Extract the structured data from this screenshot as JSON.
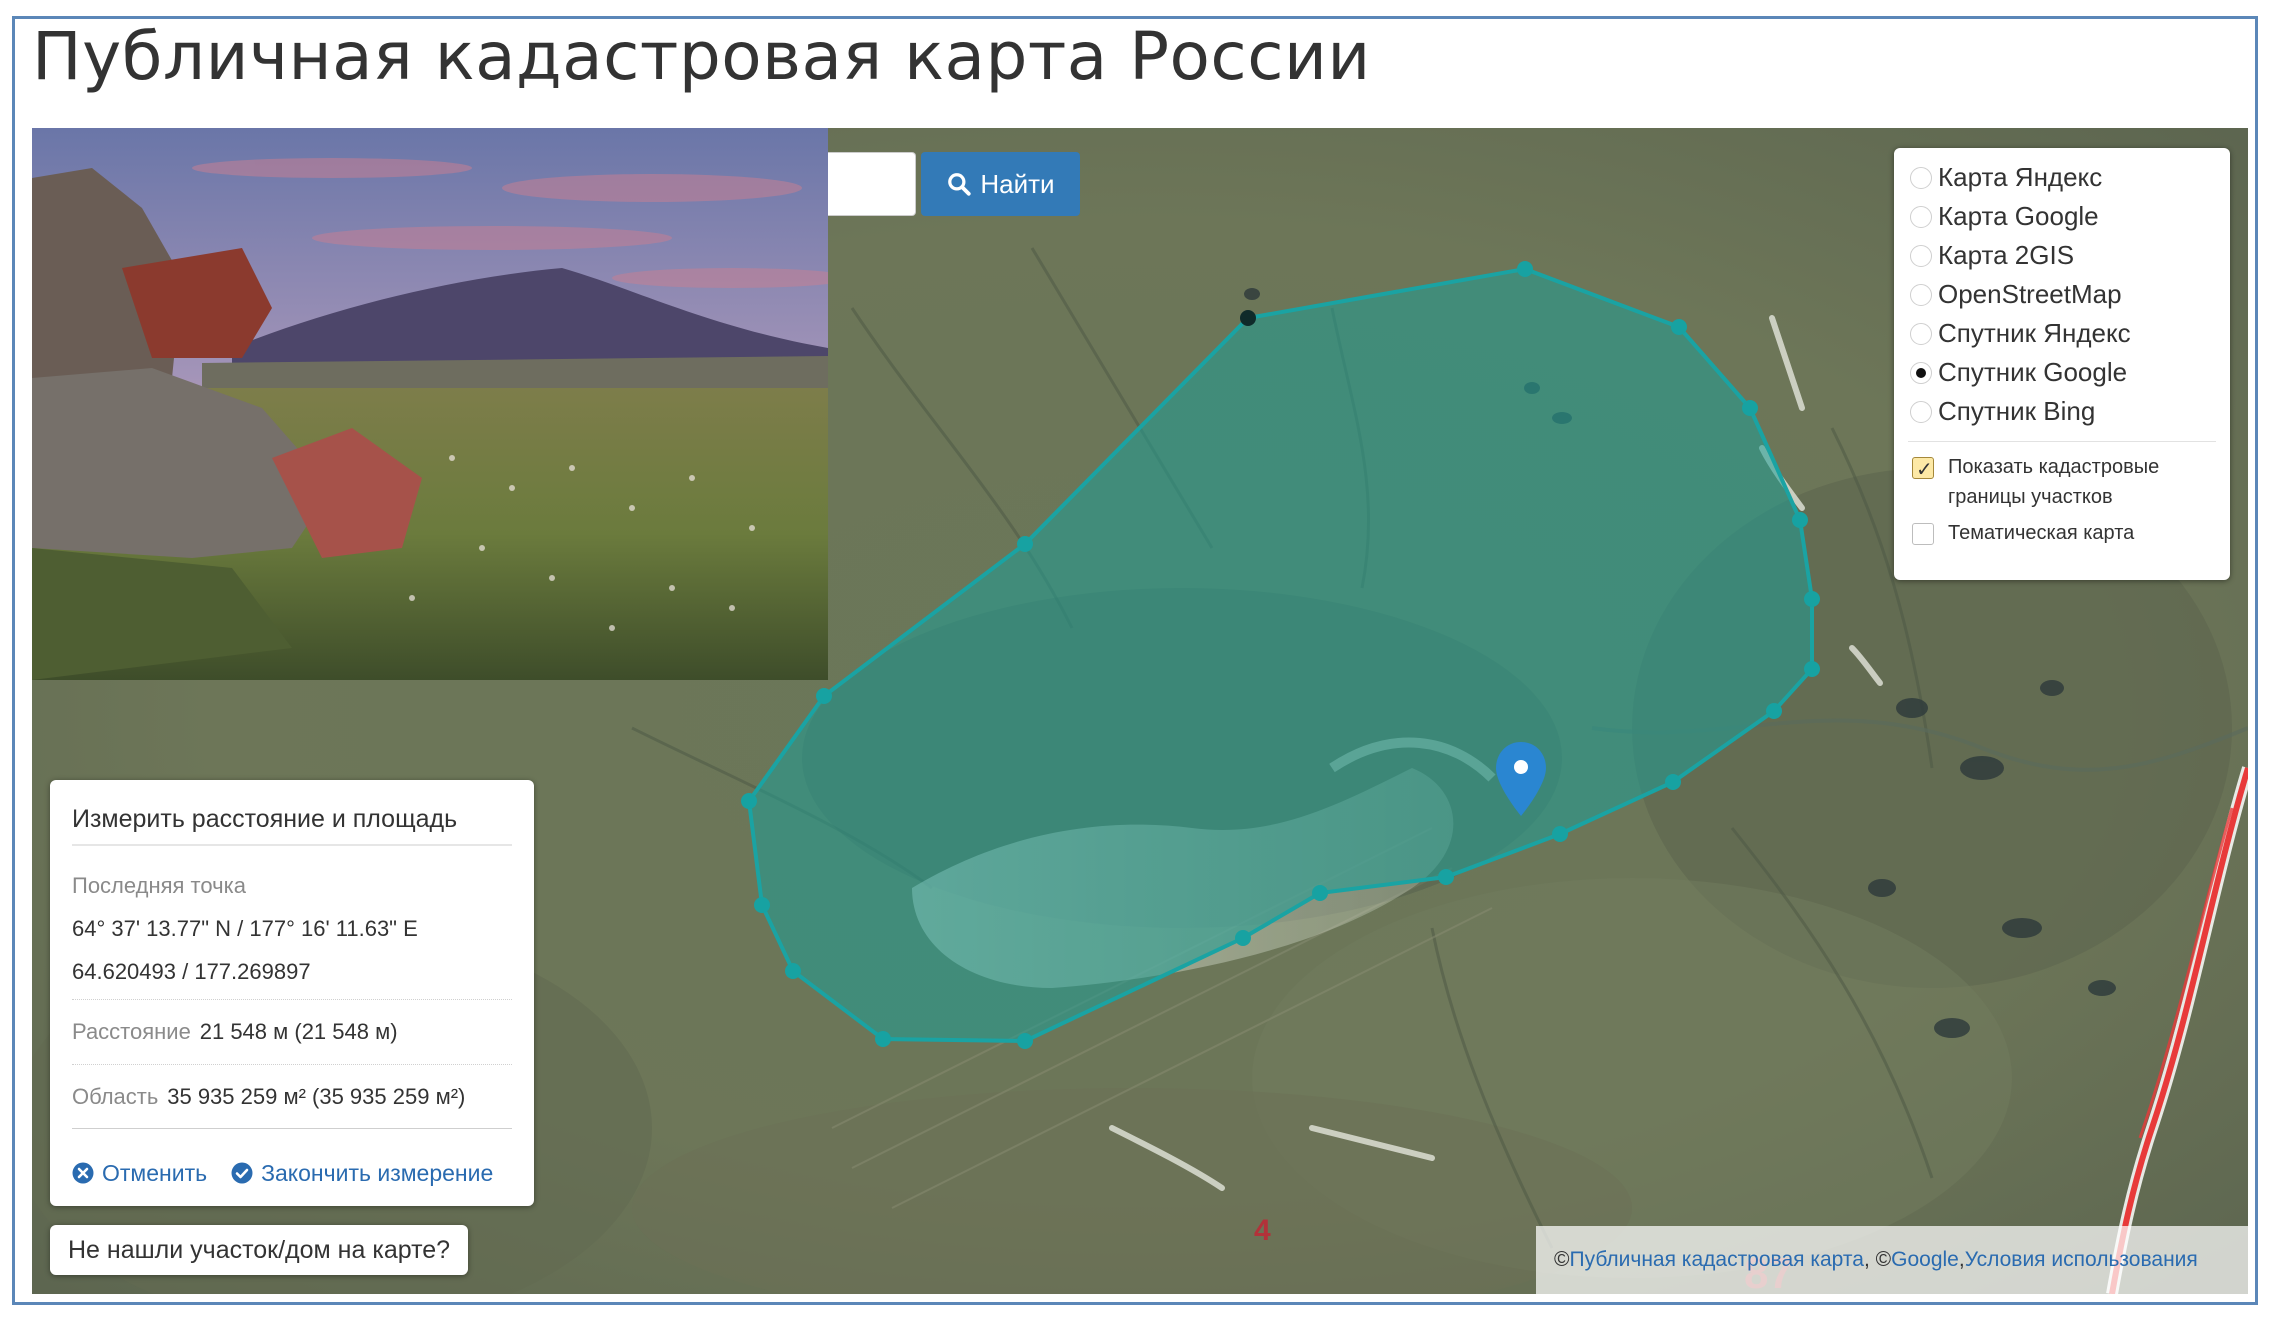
{
  "page": {
    "title": "Публичная кадастровая карта России"
  },
  "search": {
    "button_label": "Найти",
    "input_value": ""
  },
  "layers": {
    "base": [
      {
        "label": "Карта Яндекс",
        "selected": false
      },
      {
        "label": "Карта Google",
        "selected": false
      },
      {
        "label": "Карта 2GIS",
        "selected": false
      },
      {
        "label": "OpenStreetMap",
        "selected": false
      },
      {
        "label": "Спутник Яндекс",
        "selected": false
      },
      {
        "label": "Спутник Google",
        "selected": true
      },
      {
        "label": "Спутник Bing",
        "selected": false
      }
    ],
    "overlays": [
      {
        "label": "Показать кадастровые границы участков",
        "checked": true
      },
      {
        "label": "Тематическая карта",
        "checked": false
      }
    ]
  },
  "measure": {
    "title": "Измерить расстояние и площадь",
    "last_point_label": "Последняя точка",
    "last_point_dms": "64° 37' 13.77\" N / 177° 16' 11.63\" E",
    "last_point_decimal": "64.620493 / 177.269897",
    "distance_label": "Расстояние",
    "distance_value": "21 548 м (21 548 м)",
    "area_label": "Область",
    "area_value": "35 935 259 м² (35 935 259 м²)",
    "cancel_label": "Отменить",
    "finish_label": "Закончить измерение"
  },
  "notfound_label": "Не нашли участок/дом на карте?",
  "attribution": {
    "prefix": "© ",
    "pkk_link": "Публичная кадастровая карта",
    "sep": ", © ",
    "google_link": "Google",
    "comma": ", ",
    "terms_link": "Условия использования"
  },
  "map_labels": {
    "road_number_1": "4",
    "road_number_2": "87"
  },
  "colors": {
    "polygon_stroke": "#1aa3a3",
    "polygon_fill": "#1f9e96",
    "marker": "#2a86d1",
    "accent_button": "#337ab7",
    "road": "#e83a3a"
  }
}
